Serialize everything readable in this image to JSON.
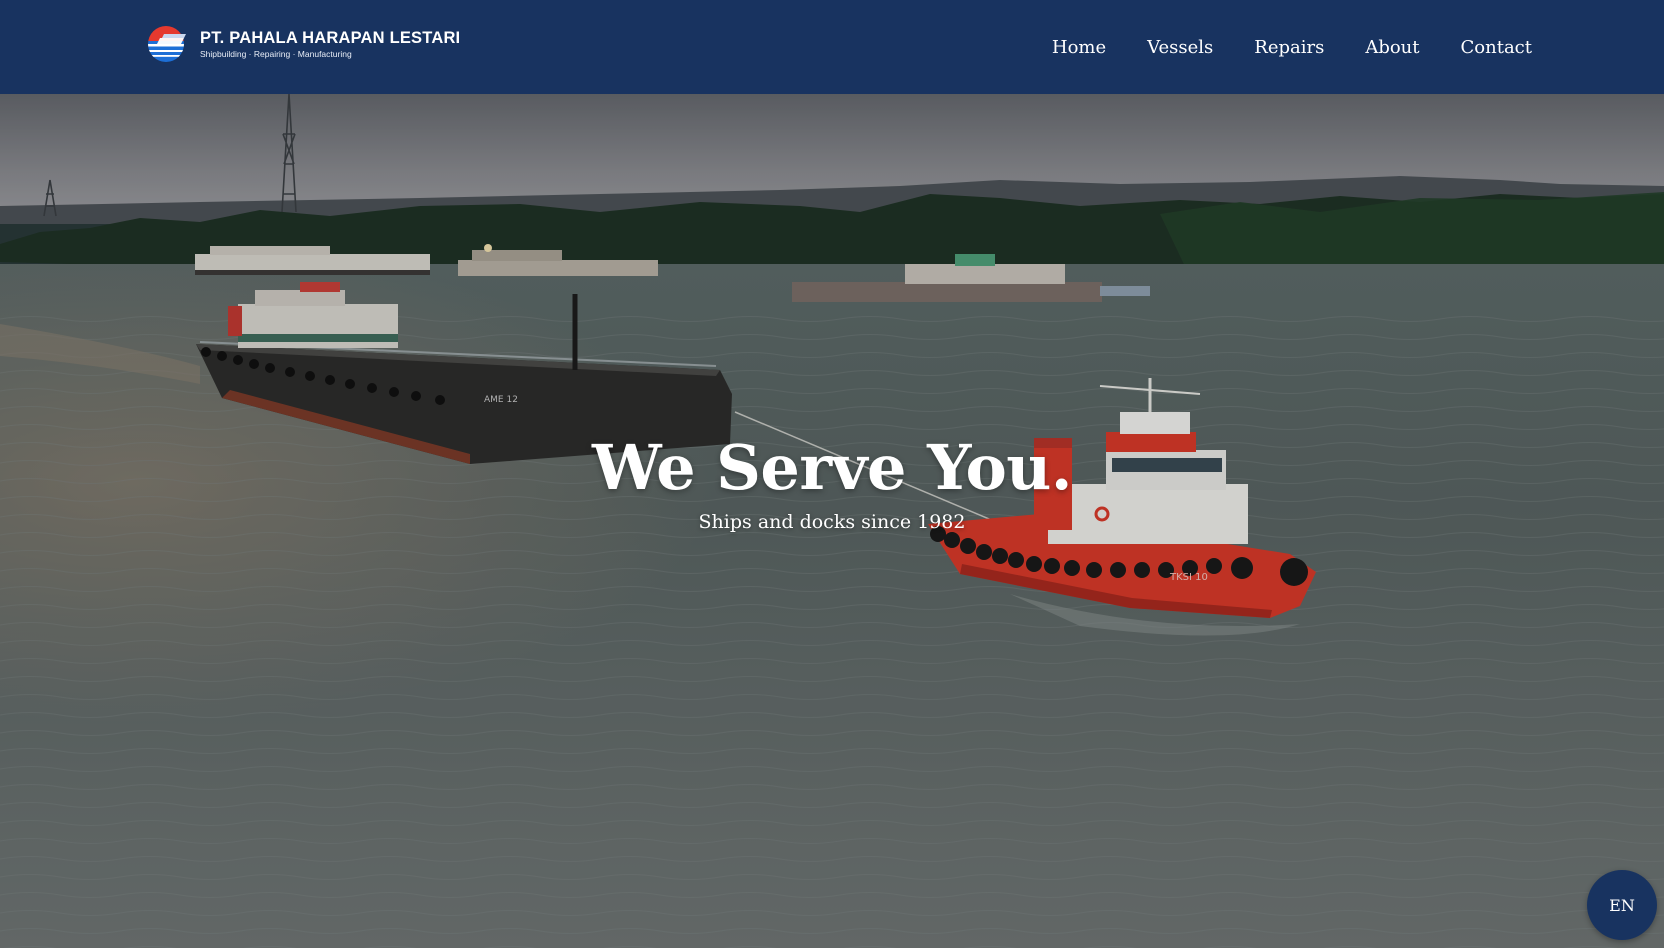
{
  "brand": {
    "name": "PT. PAHALA HARAPAN LESTARI",
    "tagline": "Shipbuilding · Repairing · Manufacturing",
    "logo_icon": "globe-ship-logo-icon"
  },
  "nav": {
    "items": [
      {
        "label": "Home"
      },
      {
        "label": "Vessels"
      },
      {
        "label": "Repairs"
      },
      {
        "label": "About"
      },
      {
        "label": "Contact"
      }
    ]
  },
  "hero": {
    "title": "We Serve You.",
    "subtitle": "Ships and docks since 1982",
    "barge_name": "AME 12",
    "tug_name": "TKSI 10"
  },
  "language_button": {
    "label": "EN"
  },
  "colors": {
    "navbar": "#183360",
    "hero_text": "#ffffff",
    "tug_red": "#d93a2a",
    "water": "#5f6c6a"
  }
}
